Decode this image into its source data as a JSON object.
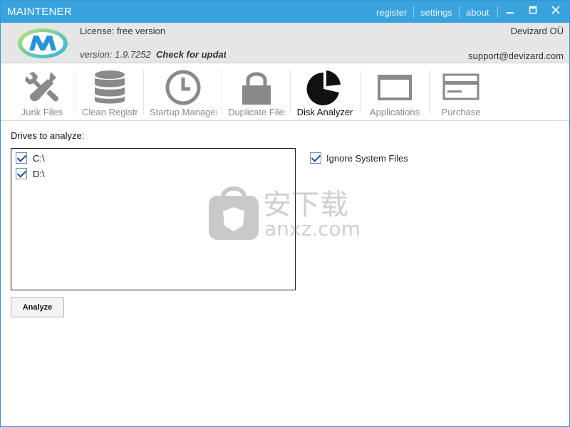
{
  "window": {
    "title": "MAINTENER",
    "links": [
      "register",
      "settings",
      "about"
    ],
    "controls": {
      "minimize": "‒",
      "maximize": "□",
      "close": "✕"
    }
  },
  "license": {
    "status": "License: free version",
    "version": "version: 1.9.7252",
    "check_updates": "Check for updates",
    "company": "Devizard OÜ",
    "support_email": "support@devizard.com"
  },
  "toolbar": {
    "items": [
      {
        "label": "Junk Files",
        "icon": "tools-icon"
      },
      {
        "label": "Clean Registry",
        "icon": "database-icon"
      },
      {
        "label": "Startup Manager",
        "icon": "clock-icon"
      },
      {
        "label": "Duplicate Files",
        "icon": "lock-icon"
      },
      {
        "label": "Disk Analyzer",
        "icon": "pie-chart-icon",
        "active": true
      },
      {
        "label": "Applications",
        "icon": "window-icon"
      },
      {
        "label": "Purchase",
        "icon": "card-icon"
      }
    ]
  },
  "main": {
    "drives_label": "Drives to analyze:",
    "drives": [
      {
        "label": "C:\\",
        "checked": true
      },
      {
        "label": "D:\\",
        "checked": true
      }
    ],
    "ignore_system_files": {
      "label": "Ignore System Files",
      "checked": true
    },
    "analyze_button": "Analyze"
  },
  "watermark": {
    "cn": "安下载",
    "en": "anxz.com"
  },
  "colors": {
    "titlebar": "#3aa3de",
    "license_bg": "#e6e6e6",
    "icon_inactive": "#8a8a8a",
    "icon_active": "#111111"
  }
}
